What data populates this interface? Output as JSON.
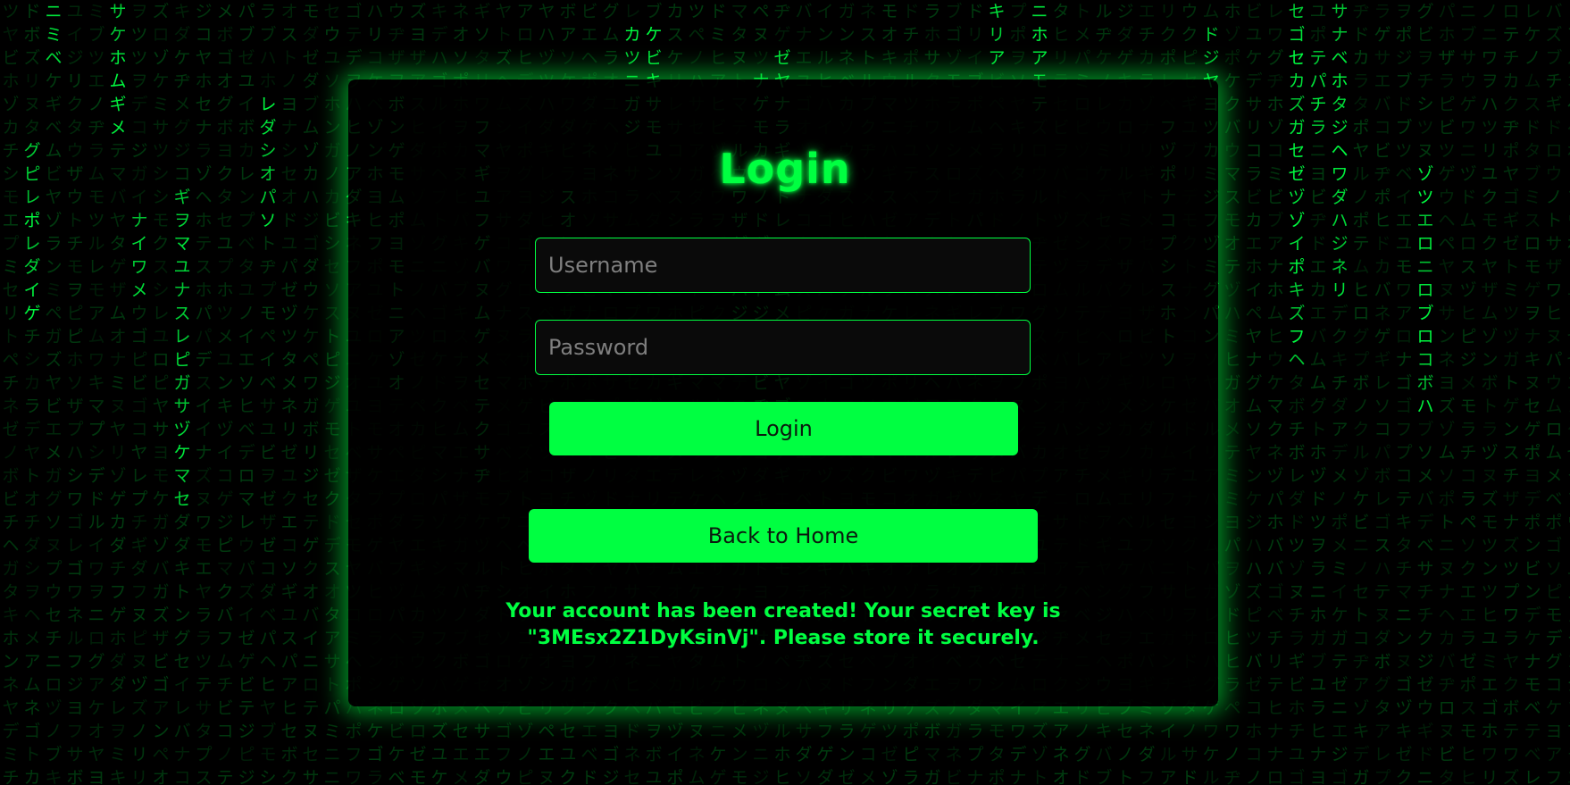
{
  "login_form": {
    "title": "Login",
    "username_placeholder": "Username",
    "password_placeholder": "Password",
    "login_button": "Login",
    "back_button": "Back to Home",
    "status_message": "Your account has been created! Your secret key is \"3MEsx2Z1DyKsinVj\". Please store it securely."
  },
  "theme": {
    "accent": "#00ff41",
    "background": "#000000",
    "panel": "#000000",
    "button_text": "#0b1a0e"
  },
  "background_rain": {
    "glyphs": "アイウエオカキクケコサシスセソタチツテトナニヌネノハヒフヘホマミムメモヤユヨラリルレロワヲンガギグゲゴザジズゼゾダヂヅデドバビブベボパピプペポ"
  }
}
